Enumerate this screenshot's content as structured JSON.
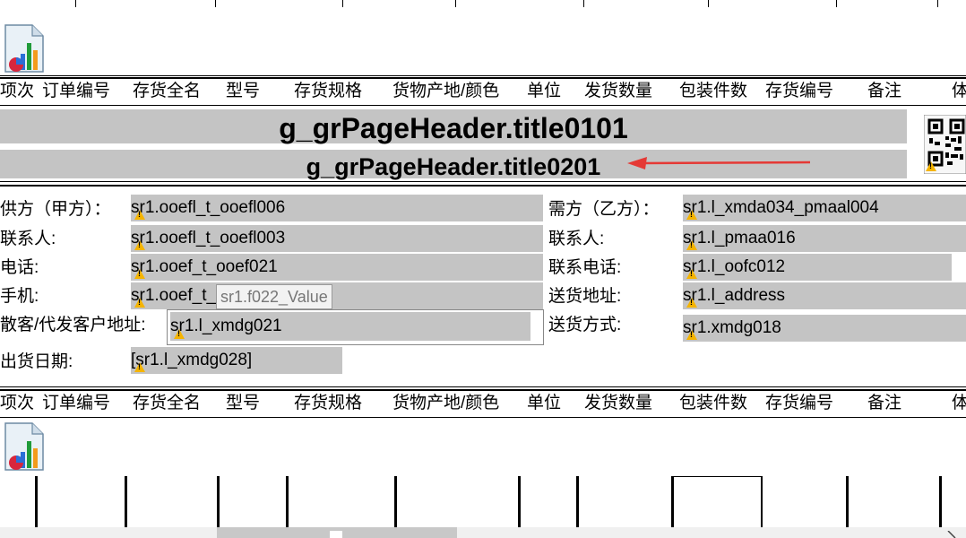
{
  "header_columns": [
    "项次",
    "订单编号",
    "存货全名",
    "型号",
    "存货规格",
    "货物产地/颜色",
    "单位",
    "发货数量",
    "包装件数",
    "存货编号",
    "备注",
    "体"
  ],
  "title1": "g_grPageHeader.title0101",
  "title2": "g_grPageHeader.title0201",
  "left_labels": [
    "供方（甲方）：",
    "联系人:",
    "电话:",
    "手机:",
    "散客/代发客户地址:",
    "出货日期:"
  ],
  "left_values": [
    "sr1.ooefl_t_ooefl006",
    "sr1.ooefl_t_ooefl003",
    "sr1.ooef_t_ooef021",
    "sr1.ooef_t_",
    "sr1.l_xmdg021",
    "[sr1.l_xmdg028]"
  ],
  "right_labels": [
    "需方（乙方）：",
    "联系人:",
    "联系电话:",
    "送货地址:",
    "送货方式:"
  ],
  "right_values": [
    "sr1.l_xmda034_pmaal004",
    "sr1.l_pmaa016",
    "sr1.l_oofc012",
    "sr1.l_address",
    "sr1.xmdg018"
  ],
  "tooltip": "sr1.f022_Value",
  "colors": {
    "field_bg": "#c4c4c4",
    "annotation_arrow": "#e53935",
    "warning": "#f5b400"
  },
  "icons": [
    "chart-icon",
    "qr-code-icon",
    "warning-icon",
    "annotation-arrow-icon"
  ]
}
